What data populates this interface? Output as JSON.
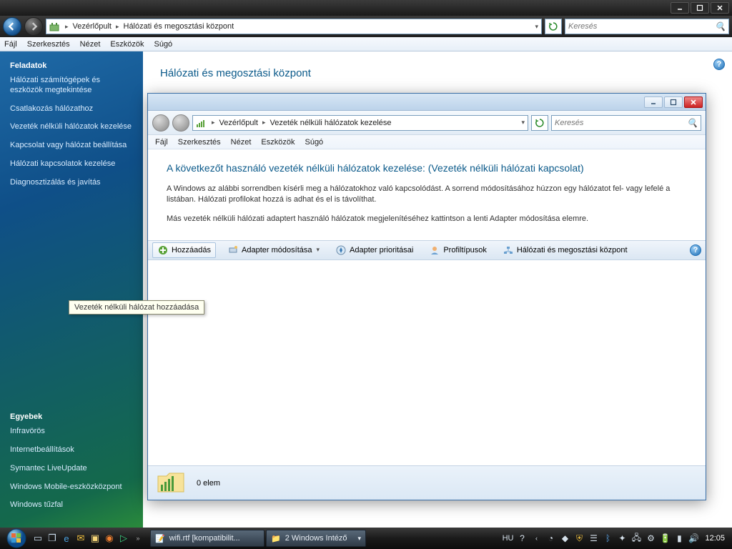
{
  "titlebar": {
    "min": "_",
    "max": "□",
    "close": "✕"
  },
  "addr": {
    "bc_root": "Vezérlőpult",
    "bc_here": "Hálózati és megosztási központ",
    "search_placeholder": "Keresés"
  },
  "menu": {
    "file": "Fájl",
    "edit": "Szerkesztés",
    "view": "Nézet",
    "tools": "Eszközök",
    "help": "Súgó"
  },
  "sidebar": {
    "tasks_title": "Feladatok",
    "items": [
      "Hálózati számítógépek és eszközök megtekintése",
      "Csatlakozás hálózathoz",
      "Vezeték nélküli hálózatok kezelése",
      "Kapcsolat vagy hálózat beállítása",
      "Hálózati kapcsolatok kezelése",
      "Diagnosztizálás és javítás"
    ],
    "others_title": "Egyebek",
    "others": [
      "Infravörös",
      "Internetbeállítások",
      "Symantec LiveUpdate",
      "Windows Mobile-eszközközpont",
      "Windows tűzfal"
    ]
  },
  "content": {
    "title": "Hálózati és megosztási központ"
  },
  "dialog": {
    "bc_root": "Vezérlőpult",
    "bc_here": "Vezeték nélküli hálózatok kezelése",
    "search_placeholder": "Keresés",
    "heading": "A következőt használó vezeték nélküli hálózatok kezelése: (Vezeték nélküli hálózati kapcsolat)",
    "para1": "A Windows az alábbi sorrendben kísérli meg a hálózatokhoz való kapcsolódást. A sorrend módosításához húzzon egy hálózatot fel- vagy lefelé a listában. Hálózati profilokat hozzá is adhat és el is távolíthat.",
    "para2": "Más vezeték nélküli hálózati adaptert használó hálózatok megjelenítéséhez kattintson a lenti Adapter módosítása elemre.",
    "toolbar": {
      "add": "Hozzáadás",
      "adapter": "Adapter módosítása",
      "priority": "Adapter prioritásai",
      "profile": "Profiltípusok",
      "center": "Hálózati és megosztási központ"
    },
    "status": "0 elem"
  },
  "tooltip": "Vezeték nélküli hálózat hozzáadása",
  "taskbar": {
    "t1": "wifi.rtf [kompatibilit...",
    "t2": "2 Windows Intéző",
    "lang": "HU",
    "clock": "12:05"
  }
}
